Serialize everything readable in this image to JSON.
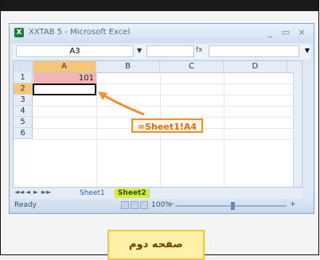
{
  "window": {
    "title": "XXTAB 5 - Microsoft Excel",
    "icon_label": "X",
    "controls": [
      "_",
      "▭",
      "×"
    ]
  },
  "formula_bar": {
    "name_box": "A3",
    "fx": "fx",
    "content": ""
  },
  "grid": {
    "columns": [
      "A",
      "B",
      "C",
      "D"
    ],
    "active_column": "A",
    "rows": [
      "1",
      "2",
      "3",
      "4",
      "5",
      "6"
    ],
    "active_row": "2",
    "a1_value": "101",
    "selected_cell": "A2"
  },
  "sheet_tabs": {
    "nav": [
      "◄◄",
      "◄",
      "►",
      "►►"
    ],
    "tabs": [
      "Sheet1",
      "Sheet2"
    ],
    "active_tab": "Sheet2"
  },
  "status": {
    "ready": "Ready",
    "zoom": "100%",
    "minus": "−",
    "plus": "+"
  },
  "callout": {
    "formula": "=Sheet1!A4"
  },
  "caption": {
    "text": "صفحه دوم"
  },
  "colors": {
    "highlight_cell": "#f2b5b5",
    "callout_border": "#f0902c",
    "active_tab": "#d8e93a",
    "caption_bg": "#fff0a8"
  }
}
